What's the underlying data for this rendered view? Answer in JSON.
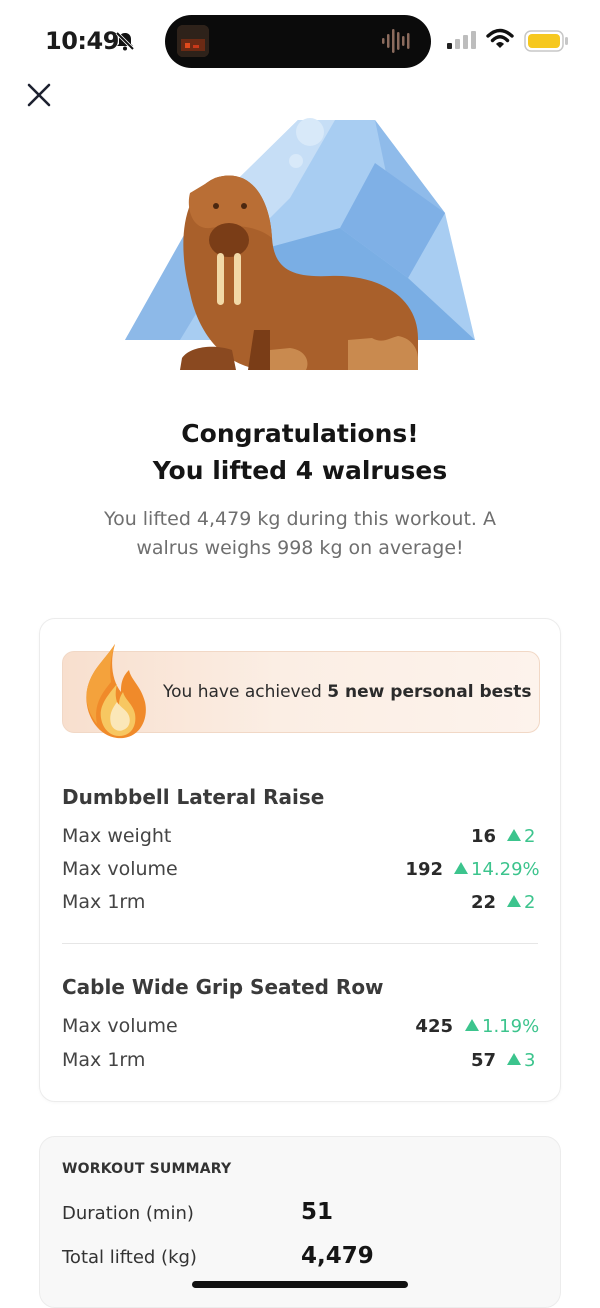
{
  "status_bar": {
    "time": "10:49",
    "icons": [
      "bell-slash-icon",
      "signal-icon",
      "wifi-icon",
      "battery-icon"
    ],
    "battery_color": "#f6c81f"
  },
  "close_icon": "close-icon",
  "hero": {
    "headline_1": "Congratulations!",
    "headline_2": "You lifted 4 walruses",
    "subline_1": "You lifted 4,479 kg during this workout. A",
    "subline_2": "walrus weighs 998 kg on average!"
  },
  "personal_bests": {
    "prefix": "You have achieved ",
    "highlight": "5 new personal bests",
    "exercises": [
      {
        "name": "Dumbbell Lateral Raise",
        "stats": [
          {
            "label": "Max weight",
            "value": "16",
            "delta": "2"
          },
          {
            "label": "Max volume",
            "value": "192",
            "delta": "14.29%"
          },
          {
            "label": "Max 1rm",
            "value": "22",
            "delta": "2"
          }
        ]
      },
      {
        "name": "Cable Wide Grip Seated Row",
        "stats": [
          {
            "label": "Max volume",
            "value": "425",
            "delta": "1.19%"
          },
          {
            "label": "Max 1rm",
            "value": "57",
            "delta": "3"
          }
        ]
      }
    ]
  },
  "summary": {
    "title": "WORKOUT SUMMARY",
    "rows": [
      {
        "label": "Duration (min)",
        "value": "51"
      },
      {
        "label": "Total lifted (kg)",
        "value": "4,479"
      }
    ]
  },
  "colors": {
    "accent_green": "#3cc48d",
    "walrus": "#a9602b",
    "iceberg": "#7fb2e6"
  }
}
